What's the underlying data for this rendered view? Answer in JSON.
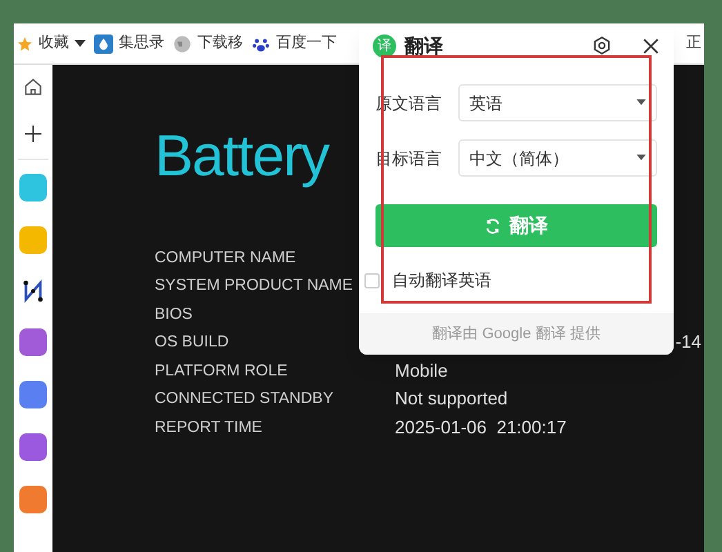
{
  "bookmarks": [
    {
      "label": "收藏",
      "kind": "star"
    },
    {
      "label": "集思录",
      "kind": "drop"
    },
    {
      "label": "下载移",
      "kind": "globe"
    },
    {
      "label": "百度一下",
      "kind": "paw"
    },
    {
      "label": "正",
      "kind": "none"
    }
  ],
  "sidebar": {
    "items": [
      {
        "kind": "home"
      },
      {
        "kind": "plus"
      },
      {
        "kind": "app",
        "color": "#2ec4e0"
      },
      {
        "kind": "app",
        "color": "#f5b800"
      },
      {
        "kind": "graph"
      },
      {
        "kind": "app",
        "color": "#a15bd8"
      },
      {
        "kind": "app",
        "color": "#5a7ff0"
      },
      {
        "kind": "app",
        "color": "#9b59e0"
      },
      {
        "kind": "app",
        "color": "#f07a30"
      }
    ]
  },
  "report": {
    "title": "Battery",
    "rows": [
      {
        "key": "COMPUTER NAME",
        "value": ""
      },
      {
        "key": "SYSTEM PRODUCT NAME",
        "value": ""
      },
      {
        "key": "BIOS",
        "value": ""
      },
      {
        "key": "OS BUILD",
        "value": "-14"
      },
      {
        "key": "PLATFORM ROLE",
        "value": "Mobile"
      },
      {
        "key": "CONNECTED STANDBY",
        "value": "Not supported"
      },
      {
        "key": "REPORT TIME",
        "value": "2025-01-06  21:00:17"
      }
    ]
  },
  "popup": {
    "logo": "译",
    "title": "翻译",
    "source_label": "原文语言",
    "source_value": "英语",
    "target_label": "目标语言",
    "target_value": "中文（简体）",
    "button": "翻译",
    "auto": {
      "label": "自动翻译英语",
      "checked": false
    },
    "footer": "翻译由 Google 翻译 提供"
  }
}
